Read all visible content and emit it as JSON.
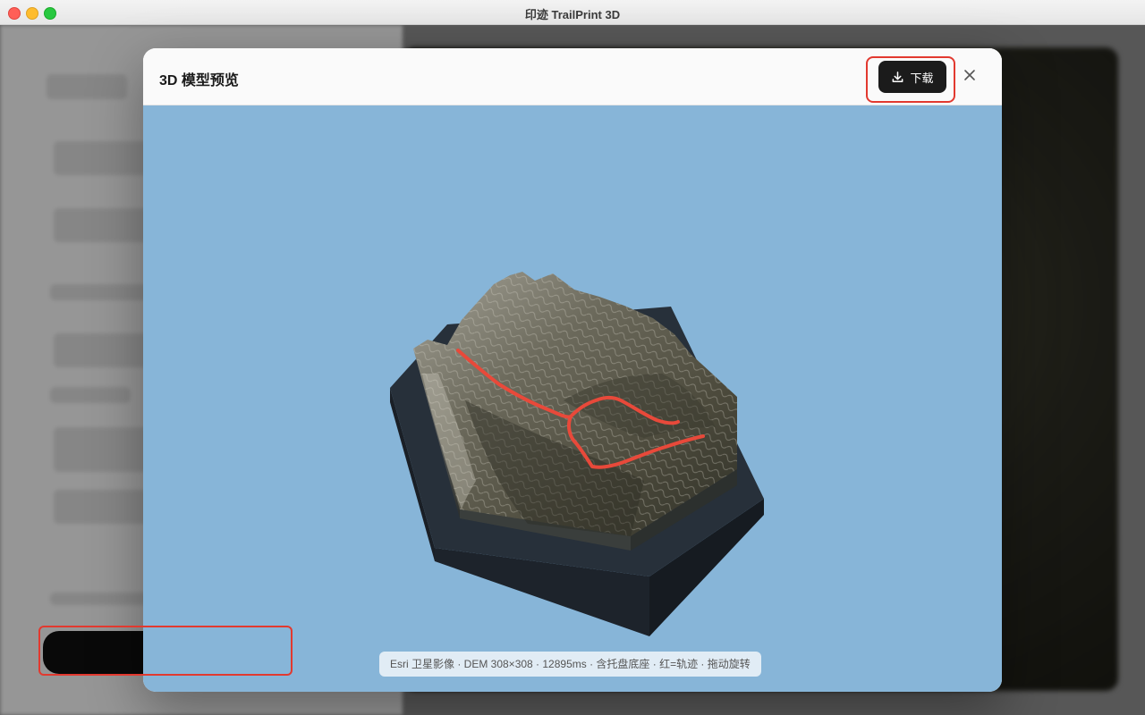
{
  "window": {
    "title": "印迹 TrailPrint 3D"
  },
  "modal": {
    "title": "3D 模型预览",
    "download_label": "下载",
    "close_icon": "close-icon",
    "download_icon": "download-icon",
    "info_text": "Esri 卫星影像 · DEM 308×308 · 12895ms · 含托盘底座 · 红=轨迹 · 拖动旋转"
  },
  "colors": {
    "viewer_bg": "#87b5d8",
    "trail": "#e8493a",
    "base": "#232a33",
    "annotation": "#e2392f"
  }
}
